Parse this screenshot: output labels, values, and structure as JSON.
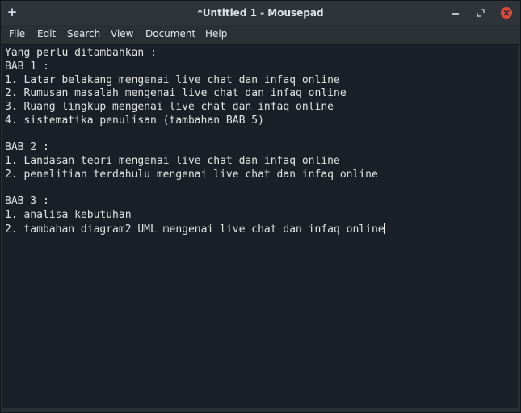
{
  "window": {
    "title": "*Untitled 1 - Mousepad",
    "pin_glyph": "+",
    "controls": {
      "minimize_icon": "minimize-icon",
      "maximize_icon": "maximize-icon",
      "close_icon": "close-icon",
      "close_color": "#e0483c"
    }
  },
  "menubar": {
    "items": [
      "File",
      "Edit",
      "Search",
      "View",
      "Document",
      "Help"
    ]
  },
  "editor": {
    "lines": [
      "Yang perlu ditambahkan :",
      "BAB 1 :",
      "1. Latar belakang mengenai live chat dan infaq online",
      "2. Rumusan masalah mengenai live chat dan infaq online",
      "3. Ruang lingkup mengenai live chat dan infaq online",
      "4. sistematika penulisan (tambahan BAB 5)",
      "",
      "BAB 2 :",
      "1. Landasan teori mengenai live chat dan infaq online",
      "2. penelitian terdahulu mengenai live chat dan infaq online",
      "",
      "BAB 3 :",
      "1. analisa kebutuhan",
      "2. tambahan diagram2 UML mengenai live chat dan infaq online"
    ],
    "background": "#1b1f27",
    "text_color": "#e2e4e7"
  }
}
